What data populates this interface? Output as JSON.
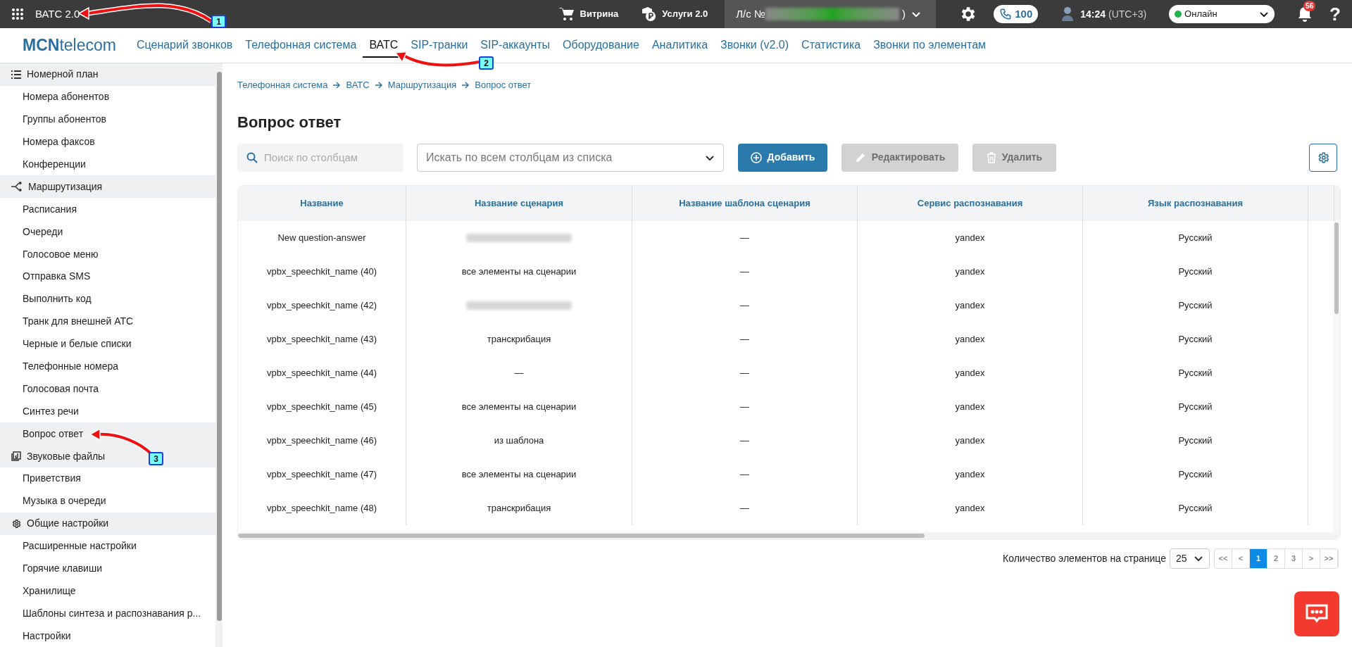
{
  "topbar": {
    "app_title": "ВАТС 2.0",
    "showcase": "Витрина",
    "services": "Услуги 2.0",
    "account_prefix": "Л/с №",
    "account_suffix": ")",
    "calls_count": "100",
    "time": "14:24",
    "timezone": "(UTC+3)",
    "status": "Онлайн",
    "notifications": "56",
    "help": "?"
  },
  "brand": {
    "bold": "MCN",
    "rest": "telecom"
  },
  "nav": [
    {
      "label": "Сценарий звонков",
      "selected": false
    },
    {
      "label": "Телефонная система",
      "selected": false
    },
    {
      "label": "ВАТС",
      "selected": true
    },
    {
      "label": "SIP-транки",
      "selected": false
    },
    {
      "label": "SIP-аккаунты",
      "selected": false
    },
    {
      "label": "Оборудование",
      "selected": false
    },
    {
      "label": "Аналитика",
      "selected": false
    },
    {
      "label": "Звонки (v2.0)",
      "selected": false
    },
    {
      "label": "Статистика",
      "selected": false
    },
    {
      "label": "Звонки по элементам",
      "selected": false
    }
  ],
  "sidebar": [
    {
      "label": "Номерной план",
      "children": [
        {
          "label": "Номера абонентов",
          "selected": false
        },
        {
          "label": "Группы абонентов",
          "selected": false
        },
        {
          "label": "Номера факсов",
          "selected": false
        },
        {
          "label": "Конференции",
          "selected": false
        }
      ]
    },
    {
      "label": "Маршрутизация",
      "children": [
        {
          "label": "Расписания",
          "selected": false
        },
        {
          "label": "Очереди",
          "selected": false
        },
        {
          "label": "Голосовое меню",
          "selected": false
        },
        {
          "label": "Отправка SMS",
          "selected": false
        },
        {
          "label": "Выполнить код",
          "selected": false
        },
        {
          "label": "Транк для внешней АТС",
          "selected": false
        },
        {
          "label": "Черные и белые списки",
          "selected": false
        },
        {
          "label": "Телефонные номера",
          "selected": false
        },
        {
          "label": "Голосовая почта",
          "selected": false
        },
        {
          "label": "Синтез речи",
          "selected": false
        },
        {
          "label": "Вопрос ответ",
          "selected": true
        }
      ]
    },
    {
      "label": "Звуковые файлы",
      "children": [
        {
          "label": "Приветствия",
          "selected": false
        },
        {
          "label": "Музыка в очереди",
          "selected": false
        }
      ]
    },
    {
      "label": "Общие настройки",
      "children": [
        {
          "label": "Расширенные настройки",
          "selected": false
        },
        {
          "label": "Горячие клавиши",
          "selected": false
        },
        {
          "label": "Хранилище",
          "selected": false
        },
        {
          "label": "Шаблоны синтеза и распознавания р...",
          "selected": false
        },
        {
          "label": "Настройки",
          "selected": false
        }
      ]
    }
  ],
  "breadcrumbs": [
    "Телефонная система",
    "ВАТС",
    "Маршрутизация",
    "Вопрос ответ"
  ],
  "page_title": "Вопрос ответ",
  "toolbar": {
    "search_placeholder": "Поиск по столбцам",
    "columns_placeholder": "Искать по всем столбцам из списка",
    "buttons": [
      {
        "label": "Добавить",
        "disabled": false
      },
      {
        "label": "Редактировать",
        "disabled": true
      },
      {
        "label": "Удалить",
        "disabled": true
      }
    ]
  },
  "table": {
    "columns": [
      "Название",
      "Название сценария",
      "Название шаблона сценария",
      "Сервис распознавания",
      "Язык распознавания"
    ],
    "rows": [
      {
        "name": "New question-answer",
        "scenario_redacted": true,
        "template": "—",
        "service": "yandex",
        "language": "Русский"
      },
      {
        "name": "vpbx_speechkit_name (40)",
        "scenario_redacted": false,
        "scenario": "все элементы на сценарии",
        "template": "—",
        "service": "yandex",
        "language": "Русский"
      },
      {
        "name": "vpbx_speechkit_name (42)",
        "scenario_redacted": true,
        "template": "—",
        "service": "yandex",
        "language": "Русский"
      },
      {
        "name": "vpbx_speechkit_name (43)",
        "scenario_redacted": false,
        "scenario": "транскрибация",
        "template": "—",
        "service": "yandex",
        "language": "Русский"
      },
      {
        "name": "vpbx_speechkit_name (44)",
        "scenario_redacted": false,
        "scenario": "—",
        "template": "—",
        "service": "yandex",
        "language": "Русский"
      },
      {
        "name": "vpbx_speechkit_name (45)",
        "scenario_redacted": false,
        "scenario": "все элементы на сценарии",
        "template": "—",
        "service": "yandex",
        "language": "Русский"
      },
      {
        "name": "vpbx_speechkit_name (46)",
        "scenario_redacted": false,
        "scenario": "из шаблона",
        "template": "—",
        "service": "yandex",
        "language": "Русский"
      },
      {
        "name": "vpbx_speechkit_name (47)",
        "scenario_redacted": false,
        "scenario": "все элементы на сценарии",
        "template": "—",
        "service": "yandex",
        "language": "Русский"
      },
      {
        "name": "vpbx_speechkit_name (48)",
        "scenario_redacted": false,
        "scenario": "транскрибация",
        "template": "—",
        "service": "yandex",
        "language": "Русский"
      }
    ]
  },
  "pagination": {
    "label": "Количество элементов на странице",
    "page_size": "25",
    "pages": [
      {
        "label": "<<",
        "selected": false
      },
      {
        "label": "<",
        "selected": false
      },
      {
        "label": "1",
        "selected": true
      },
      {
        "label": "2",
        "selected": false
      },
      {
        "label": "3",
        "selected": false
      },
      {
        "label": ">",
        "selected": false
      },
      {
        "label": ">>",
        "selected": false
      }
    ]
  },
  "annotations": [
    {
      "number": "1"
    },
    {
      "number": "2"
    },
    {
      "number": "3"
    }
  ]
}
